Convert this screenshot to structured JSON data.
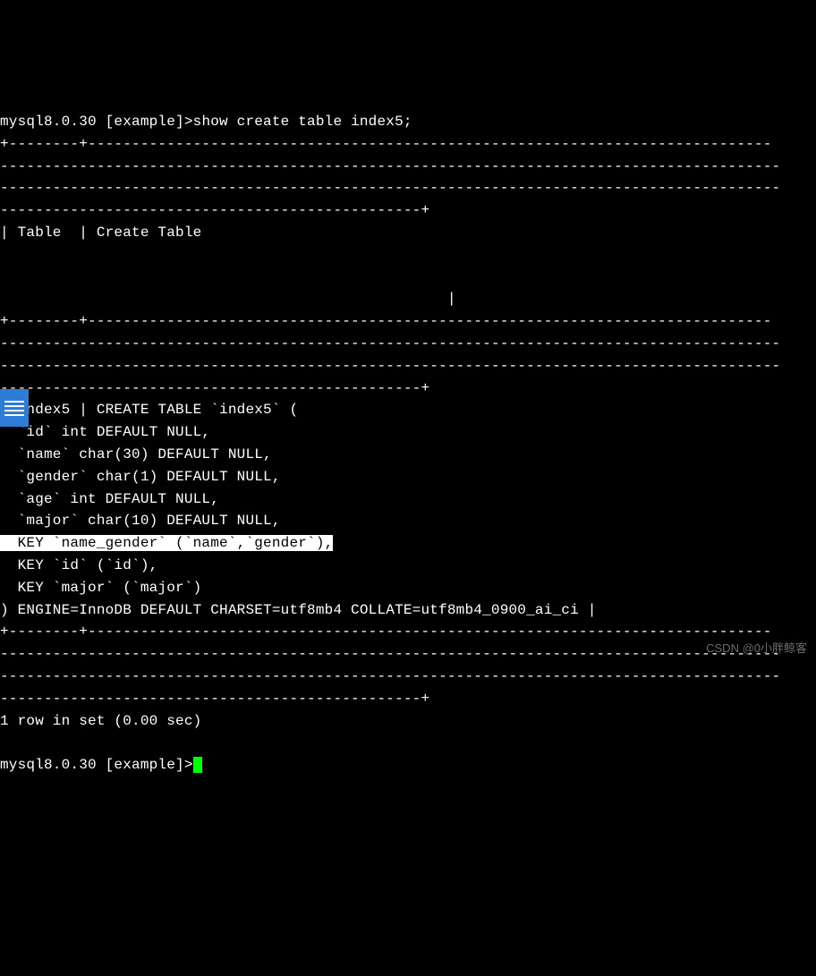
{
  "prompt1": "mysql8.0.30 [example]>",
  "command": "show create table index5;",
  "sep_top1": "+--------+------------------------------------------------------------------------------",
  "sep_top2": "-----------------------------------------------------------------------------------------",
  "sep_top3": "-----------------------------------------------------------------------------------------",
  "sep_top4": "------------------------------------------------+",
  "header": "| Table  | Create Table",
  "header_tail": "                                                   |",
  "sep_mid1": "+--------+------------------------------------------------------------------------------",
  "sep_mid2": "-----------------------------------------------------------------------------------------",
  "sep_mid3": "-----------------------------------------------------------------------------------------",
  "sep_mid4": "------------------------------------------------+",
  "row1": "| index5 | CREATE TABLE `index5` (",
  "row2": "  `id` int DEFAULT NULL,",
  "row3": "  `name` char(30) DEFAULT NULL,",
  "row4": "  `gender` char(1) DEFAULT NULL,",
  "row5": "  `age` int DEFAULT NULL,",
  "row6": "  `major` char(10) DEFAULT NULL,",
  "row7": "  KEY `name_gender` (`name`,`gender`),",
  "row8": "  KEY `id` (`id`),",
  "row9": "  KEY `major` (`major`)",
  "row10": ") ENGINE=InnoDB DEFAULT CHARSET=utf8mb4 COLLATE=utf8mb4_0900_ai_ci |",
  "sep_bot1": "+--------+------------------------------------------------------------------------------",
  "sep_bot2": "-----------------------------------------------------------------------------------------",
  "sep_bot3": "-----------------------------------------------------------------------------------------",
  "sep_bot4": "------------------------------------------------+",
  "result": "1 row in set (0.00 sec)",
  "prompt2": "mysql8.0.30 [example]>",
  "watermark": "CSDN @0小胖鲸客"
}
